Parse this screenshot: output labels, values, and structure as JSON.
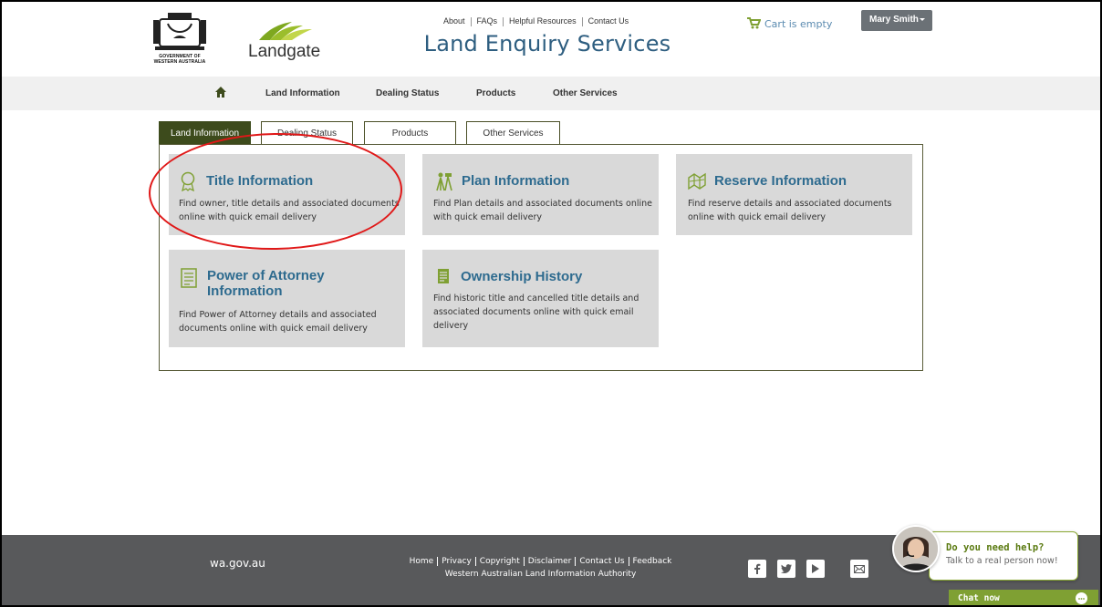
{
  "header": {
    "gov_label_line1": "GOVERNMENT OF",
    "gov_label_line2": "WESTERN AUSTRALIA",
    "brand_name": "Landgate",
    "top_links": [
      "About",
      "FAQs",
      "Helpful Resources",
      "Contact Us"
    ],
    "site_title": "Land Enquiry Services",
    "cart_text": "Cart is empty",
    "user_name": "Mary Smith"
  },
  "nav": {
    "items": [
      "Land Information",
      "Dealing Status",
      "Products",
      "Other Services"
    ]
  },
  "tabs": [
    {
      "label": "Land Information",
      "active": true
    },
    {
      "label": "Dealing Status",
      "active": false
    },
    {
      "label": "Products",
      "active": false
    },
    {
      "label": "Other Services",
      "active": false
    }
  ],
  "cards": [
    {
      "title": "Title Information",
      "desc_line1": "Find owner, title details and associated documents",
      "desc_line2": "online with quick email delivery",
      "icon": "ribbon-award-icon"
    },
    {
      "title": "Plan Information",
      "desc_line1": "Find Plan details and associated documents online",
      "desc_line2": "with quick email delivery",
      "icon": "surveyor-icon"
    },
    {
      "title": "Reserve Information",
      "desc_line1": "Find reserve details and associated documents",
      "desc_line2": "online with quick email delivery",
      "icon": "map-icon"
    },
    {
      "title_line1": "Power of Attorney",
      "title_line2": "Information",
      "desc_line1": "Find Power of Attorney details and associated",
      "desc_line2": "documents online with quick email delivery",
      "icon": "document-list-icon"
    },
    {
      "title": "Ownership History",
      "desc_line1": "Find historic title and cancelled title details and",
      "desc_line2": "associated documents online with quick email",
      "desc_line3": "delivery",
      "icon": "history-document-icon"
    }
  ],
  "footer": {
    "wa_link": "wa.gov.au",
    "links": [
      "Home",
      "Privacy",
      "Copyright",
      "Disclaimer",
      "Contact Us",
      "Feedback"
    ],
    "authority": "Western Australian Land Information Authority",
    "social": [
      "facebook-icon",
      "twitter-icon",
      "youtube-icon",
      "email-icon"
    ]
  },
  "chat": {
    "title": "Do you need help?",
    "subtitle": "Talk to a real person now!",
    "button": "Chat now"
  },
  "colors": {
    "accent_green": "#3d4b1c",
    "title_blue": "#2e5e80",
    "card_bg": "#d9d9d9",
    "footer_bg": "#58595b",
    "chat_green": "#7fa033",
    "annotation_red": "#e01818"
  }
}
